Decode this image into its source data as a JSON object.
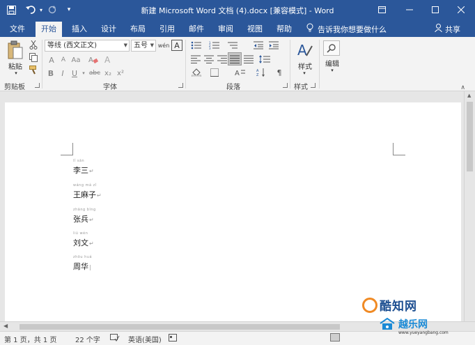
{
  "window": {
    "title": "新建 Microsoft Word 文档 (4).docx [兼容模式] - Word"
  },
  "tabs": [
    {
      "label": "文件"
    },
    {
      "label": "开始"
    },
    {
      "label": "插入"
    },
    {
      "label": "设计"
    },
    {
      "label": "布局"
    },
    {
      "label": "引用"
    },
    {
      "label": "邮件"
    },
    {
      "label": "审阅"
    },
    {
      "label": "视图"
    },
    {
      "label": "帮助"
    }
  ],
  "tell_me": "告诉我你想要做什么",
  "share": "共享",
  "ribbon": {
    "clipboard": {
      "paste": "粘贴",
      "group": "剪贴板"
    },
    "font": {
      "name": "等线 (西文正文)",
      "size": "五号",
      "group": "字体"
    },
    "paragraph": {
      "group": "段落"
    },
    "styles": {
      "label": "样式",
      "group": "样式"
    },
    "editing": {
      "label": "编辑"
    }
  },
  "document": {
    "lines": [
      {
        "text": "李三",
        "pinyin": "lǐ sān"
      },
      {
        "text": "王麻子",
        "pinyin": "wáng má zǐ"
      },
      {
        "text": "张兵",
        "pinyin": "zhāng bīng"
      },
      {
        "text": "刘文",
        "pinyin": "liú wén"
      },
      {
        "text": "周华",
        "pinyin": "zhōu huá"
      }
    ],
    "paragraph_mark": "↵"
  },
  "status": {
    "page": "第 1 页，共 1 页",
    "words": "22 个字",
    "language": "英语(美国)"
  },
  "watermark": {
    "brand1": "酷知网",
    "brand2": "越乐网",
    "url": "www.yueyangbang.com"
  },
  "colors": {
    "accent": "#2b579a",
    "ribbon_bg": "#f3f3f3",
    "doc_bg": "#e6e6e6"
  }
}
